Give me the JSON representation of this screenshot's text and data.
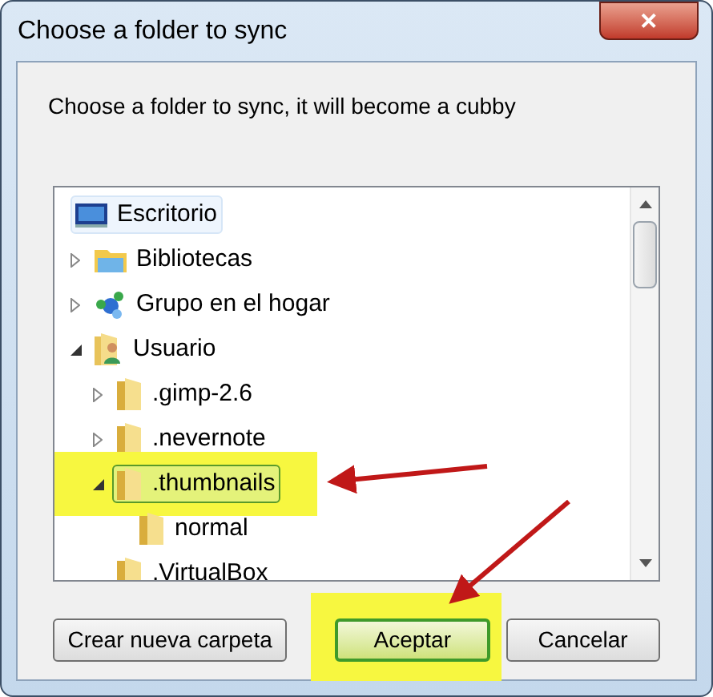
{
  "window": {
    "title": "Choose a folder to sync",
    "close_button": "✕"
  },
  "message": "Choose a folder to sync, it will become a cubby",
  "tree": [
    {
      "label": "Escritorio",
      "kind": "desktop",
      "hovered": true,
      "selected": false,
      "annotated": false,
      "children": [
        {
          "label": "Bibliotecas",
          "kind": "library",
          "hovered": false,
          "selected": false,
          "annotated": false,
          "expanded": false
        },
        {
          "label": "Grupo en el hogar",
          "kind": "homegroup",
          "hovered": false,
          "selected": false,
          "annotated": false,
          "expanded": false
        },
        {
          "label": "Usuario",
          "kind": "user",
          "hovered": false,
          "selected": false,
          "annotated": false,
          "expanded": true,
          "children": [
            {
              "label": ".gimp-2.6",
              "kind": "folder",
              "hovered": false,
              "selected": false,
              "annotated": false,
              "expanded": false
            },
            {
              "label": ".nevernote",
              "kind": "folder",
              "hovered": false,
              "selected": false,
              "annotated": false,
              "expanded": false
            },
            {
              "label": ".thumbnails",
              "kind": "folder",
              "hovered": false,
              "selected": true,
              "annotated": true,
              "expanded": true,
              "children": [
                {
                  "label": "normal",
                  "kind": "folder",
                  "hovered": false,
                  "selected": false,
                  "annotated": false
                }
              ]
            },
            {
              "label": ".VirtualBox",
              "kind": "folder",
              "hovered": false,
              "selected": false,
              "annotated": false
            }
          ]
        }
      ]
    }
  ],
  "buttons": [
    {
      "label": "Crear nueva carpeta",
      "default": false,
      "annotated": false
    },
    {
      "label": "Aceptar",
      "default": true,
      "annotated": true
    },
    {
      "label": "Cancelar",
      "default": false,
      "annotated": false
    }
  ]
}
